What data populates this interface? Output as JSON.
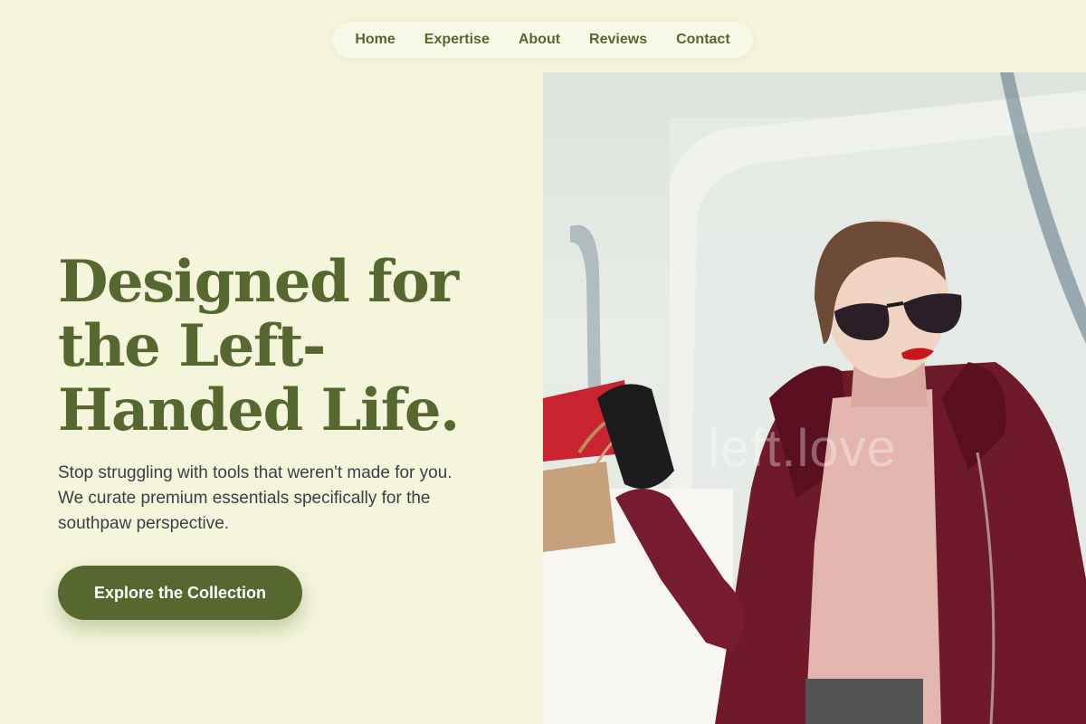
{
  "nav": {
    "items": [
      "Home",
      "Expertise",
      "About",
      "Reviews",
      "Contact"
    ]
  },
  "hero": {
    "headline": "Designed for\nthe Left-\nHanded Life.",
    "subtext": "Stop struggling with tools that weren't made for you. We curate premium essentials specifically for the southpaw perspective.",
    "cta_label": "Explore the Collection"
  },
  "photo": {
    "watermark": "left.love"
  },
  "colors": {
    "background": "#f4f5da",
    "accent": "#56682f",
    "text": "#3a4048"
  }
}
